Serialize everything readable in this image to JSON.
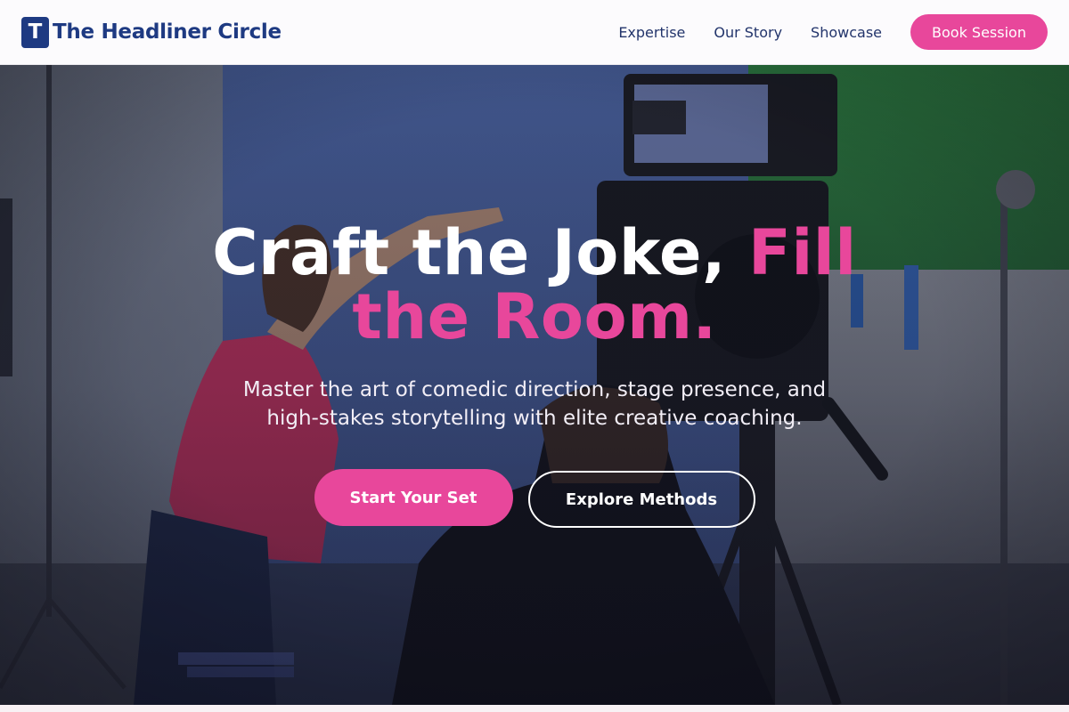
{
  "header": {
    "logo_letter": "T",
    "brand": "The Headliner Circle",
    "nav": [
      {
        "label": "Expertise"
      },
      {
        "label": "Our Story"
      },
      {
        "label": "Showcase"
      }
    ],
    "cta_label": "Book Session"
  },
  "hero": {
    "headline_main": "Craft the Joke, ",
    "headline_accent": "Fill the Room.",
    "subhead": "Master the art of comedic direction, stage presence, and high-stakes storytelling with elite creative coaching.",
    "primary_cta": "Start Your Set",
    "secondary_cta": "Explore Methods"
  },
  "colors": {
    "brand_navy": "#1e3a82",
    "accent_pink": "#e8479b"
  }
}
